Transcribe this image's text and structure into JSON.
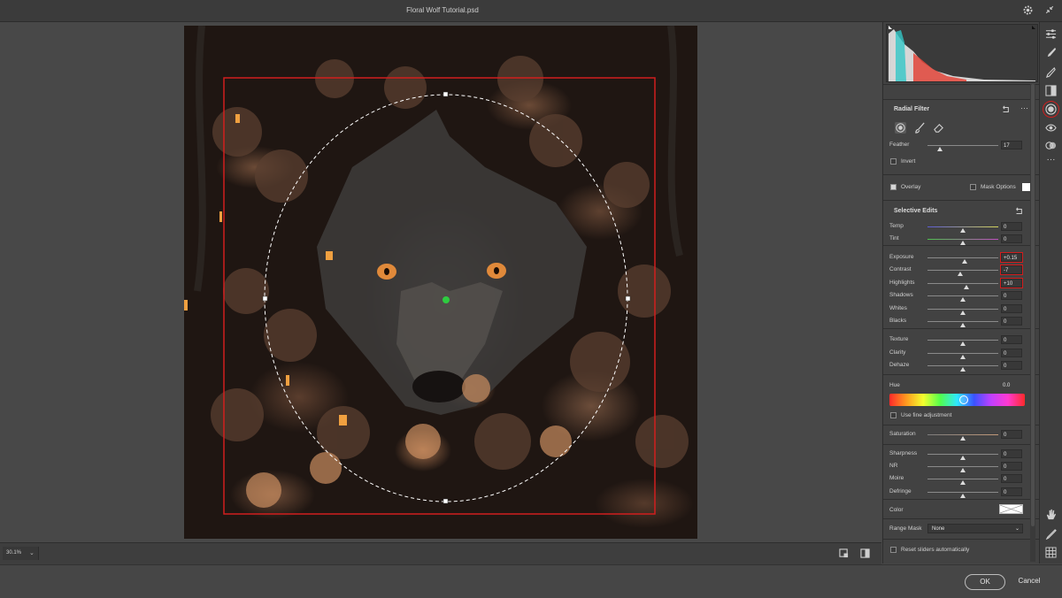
{
  "window": {
    "title": "Floral Wolf Tutorial.psd"
  },
  "zoom": {
    "value": "30.1%"
  },
  "footer": {
    "ok_label": "OK",
    "cancel_label": "Cancel"
  },
  "panel": {
    "title": "Radial Filter",
    "feather": {
      "label": "Feather",
      "value": "17",
      "level": 0.17
    },
    "invert_label": "Invert",
    "overlay_label": "Overlay",
    "mask_options_label": "Mask Options",
    "selective_edits_title": "Selective Edits",
    "sliders": [
      {
        "label": "Temp",
        "value": "0",
        "level": 0.5
      },
      {
        "label": "Tint",
        "value": "0",
        "level": 0.5
      },
      {
        "label": "Exposure",
        "value": "+0.15",
        "level": 0.52
      },
      {
        "label": "Contrast",
        "value": "-7",
        "level": 0.46
      },
      {
        "label": "Highlights",
        "value": "+10",
        "level": 0.55
      },
      {
        "label": "Shadows",
        "value": "0",
        "level": 0.5
      },
      {
        "label": "Whites",
        "value": "0",
        "level": 0.5
      },
      {
        "label": "Blacks",
        "value": "0",
        "level": 0.5
      },
      {
        "label": "Texture",
        "value": "0",
        "level": 0.5
      },
      {
        "label": "Clarity",
        "value": "0",
        "level": 0.5
      },
      {
        "label": "Dehaze",
        "value": "0",
        "level": 0.5
      }
    ],
    "hue": {
      "label": "Hue",
      "value": "0.0"
    },
    "fine_adjustment_label": "Use fine adjustment",
    "saturation": {
      "label": "Saturation",
      "value": "0",
      "level": 0.5
    },
    "detail_sliders": [
      {
        "label": "Sharpness",
        "value": "0",
        "level": 0.5
      },
      {
        "label": "NR",
        "value": "0",
        "level": 0.5
      },
      {
        "label": "Moire",
        "value": "0",
        "level": 0.5
      },
      {
        "label": "Defringe",
        "value": "0",
        "level": 0.5
      }
    ],
    "color_label": "Color",
    "range_mask": {
      "label": "Range Mask",
      "value": "None"
    },
    "reset_label": "Reset sliders automatically"
  },
  "colors": {
    "highlight": "#d11e1e",
    "panel_bg": "#424242",
    "overlay_ellipse": "#ffffff"
  }
}
